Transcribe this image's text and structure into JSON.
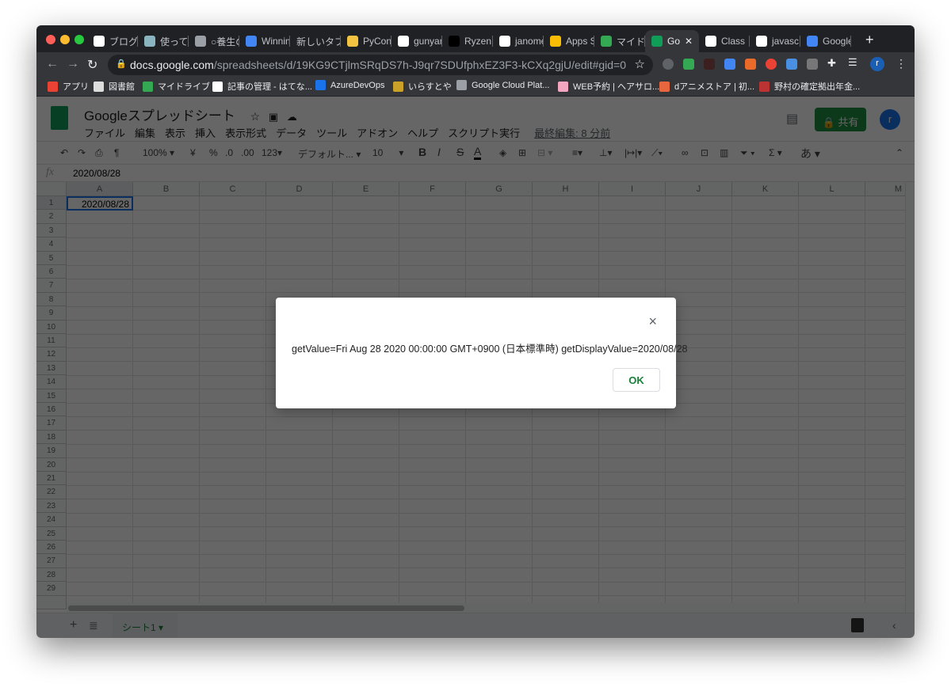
{
  "browser": {
    "tabs": [
      {
        "label": "ブログ",
        "color": "#ffffff"
      },
      {
        "label": "使って",
        "color": "#8ab4c0"
      },
      {
        "label": "○養生の",
        "color": "#9aa0a6"
      },
      {
        "label": "Winnin",
        "color": "#4285f4"
      },
      {
        "label": "新しいタブ",
        "color": ""
      },
      {
        "label": "PyCon",
        "color": "#f5c342"
      },
      {
        "label": "gunyar",
        "color": "#ffffff"
      },
      {
        "label": "Ryzen",
        "color": "#000000"
      },
      {
        "label": "janome",
        "color": "#ffffff"
      },
      {
        "label": "Apps S",
        "color": "#fbbc04"
      },
      {
        "label": "マイド",
        "color": "#34a853"
      },
      {
        "label": "Go",
        "color": "#0f9d58",
        "active": true
      },
      {
        "label": "Class",
        "color": "#ffffff"
      },
      {
        "label": "javasc",
        "color": "#ffffff"
      },
      {
        "label": "Google",
        "color": "#4285f4"
      }
    ],
    "new_tab": "+",
    "close_tab": "✕",
    "url_host": "docs.google.com",
    "url_path": "/spreadsheets/d/19KG9CTjlmSRqDS7h-J9qr7SDUfphxEZ3F3-kCXq2gjU/edit#gid=0",
    "profile_initial": "r",
    "bookmarks": [
      "アプリ",
      "図書館",
      "マイドライブ",
      "記事の管理 - はてな...",
      "AzureDevOps",
      "いらすとや",
      "Google Cloud Plat...",
      "WEB予約 | ヘアサロ...",
      "dアニメストア | 初...",
      "野村の確定拠出年金..."
    ]
  },
  "sheets": {
    "title": "Googleスプレッドシート",
    "menu": [
      "ファイル",
      "編集",
      "表示",
      "挿入",
      "表示形式",
      "データ",
      "ツール",
      "アドオン",
      "ヘルプ",
      "スクリプト実行"
    ],
    "last_edit": "最終編集: 8 分前",
    "share_label": "共有",
    "avatar": "r",
    "toolbar": {
      "zoom": "100%",
      "currency": "¥",
      "percent": "%",
      "dec_less": ".0",
      "dec_more": ".00",
      "format": "123▾",
      "font": "デフォルト...",
      "size": "10",
      "bold": "B",
      "italic": "I",
      "strike": "S",
      "color": "A",
      "input": "あ"
    },
    "formula_icon": "fx",
    "formula_value": "2020/08/28",
    "columns": [
      "A",
      "B",
      "C",
      "D",
      "E",
      "F",
      "G",
      "H",
      "I",
      "J",
      "K",
      "L",
      "M"
    ],
    "row_count": 29,
    "cell_a1": "2020/08/28",
    "sheet_tab": "シート1",
    "accent": "#0f9d58"
  },
  "dialog": {
    "message": "getValue=Fri Aug 28 2020 00:00:00 GMT+0900 (日本標準時) getDisplayValue=2020/08/28",
    "ok_label": "OK",
    "close": "×"
  }
}
